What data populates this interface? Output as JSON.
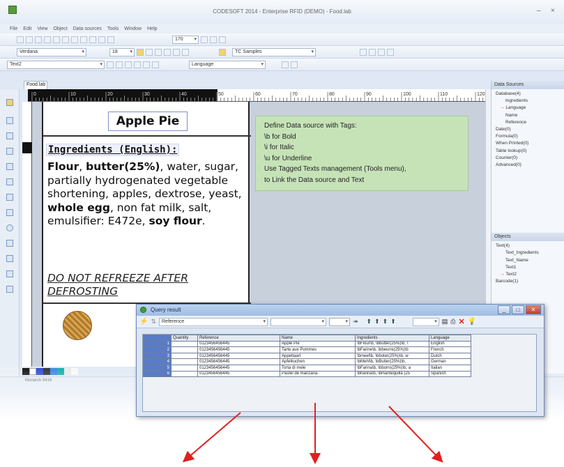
{
  "window": {
    "title": "CODESOFT 2014 - Enterprise RFID (DEMO) - Food.lab",
    "minimize": "–",
    "close": "×"
  },
  "menu": [
    "File",
    "Edit",
    "View",
    "Object",
    "Data sources",
    "Tools",
    "Window",
    "Help"
  ],
  "toolbar": {
    "font_name": "Verdana",
    "font_size": "18",
    "zoom": "170",
    "tc_samples": "TC Samples",
    "object_name": "Text2",
    "language": "Language"
  },
  "document": {
    "tab_label": "Food.lab",
    "ruler_numbers": [
      "0",
      "10",
      "20",
      "30",
      "40",
      "50",
      "60",
      "70",
      "80",
      "90",
      "100",
      "110",
      "120"
    ],
    "label_title": "Apple Pie",
    "ingredients_heading": "Ingredients (English):",
    "ingredients_line1_bold": "Flour",
    "ingredients_line1_rest": ", ",
    "ingredients_line1_bold2": "butter(25%)",
    "ingredients_line1_end": ",",
    "ingredients_body1": "water, sugar, partially hydrogenated vegetable shortening, apples, dextrose, yeast, ",
    "ingredients_bold3": "whole egg",
    "ingredients_body2": ", non fat milk, salt, emulsifier: E472e, ",
    "ingredients_bold4": "soy flour",
    "ingredients_end": ".",
    "warning": "DO NOT REFREEZE AFTER DEFROSTING",
    "note_lines": [
      "Define Data source with Tags:",
      "\\b for Bold",
      "\\i for Italic",
      "\\u for Underline",
      "Use Tagged Texts management (Tools menu),",
      "to Link the Data source and Text"
    ]
  },
  "data_sources_panel": {
    "title": "Data Sources",
    "items": [
      "Database(4)",
      "Ingredients",
      "Language",
      "Name",
      "Reference",
      "Date(0)",
      "Formula(0)",
      "When Printed(0)",
      "Table lookup(0)",
      "Counter(0)",
      "Advanced(0)"
    ]
  },
  "objects_panel": {
    "title": "Objects",
    "items": [
      "Text(4)",
      "Text_Ingredients",
      "Text_Name",
      "Text1",
      "Text2",
      "Barcode(1)"
    ]
  },
  "status": {
    "printer": "Monarch 9416"
  },
  "query_dialog": {
    "title": "Query result",
    "filter_field": "Reference",
    "columns": [
      "Quantity",
      "Reference",
      "Name",
      "Ingredients",
      "Language"
    ],
    "rows": [
      {
        "idx": "1",
        "quantity": "",
        "reference": "0123456456445",
        "name": "Apple Pie",
        "ingredients": "\\bFlour\\b, \\bbutter(25%)\\b, \\",
        "language": "English"
      },
      {
        "idx": "2",
        "quantity": "",
        "reference": "0123456456445",
        "name": "Tarte aux Pommes",
        "ingredients": "\\bFarine\\b, \\bbeurre(25%)\\b",
        "language": "French"
      },
      {
        "idx": "3",
        "quantity": "",
        "reference": "0123456456445",
        "name": "Appeltaart",
        "ingredients": "\\bmeel\\b, \\bboter(25%)\\b, w",
        "language": "Dutch"
      },
      {
        "idx": "4",
        "quantity": "",
        "reference": "0123456456445",
        "name": "Apfelkuchen",
        "ingredients": "\\bMehl\\b, \\bButter(25%)\\b,",
        "language": "German"
      },
      {
        "idx": "5",
        "quantity": "",
        "reference": "0123456456445",
        "name": "Torta di mele",
        "ingredients": "\\bFarina\\b, \\bburro(25%)\\b, a",
        "language": "Italian"
      },
      {
        "idx": "6",
        "quantity": "",
        "reference": "0123456456445",
        "name": "Pastel de manzana",
        "ingredients": "\\bharina\\b, \\bmantequilla (25",
        "language": "Spanish"
      }
    ]
  },
  "colors": {
    "note_bg": "#c6e3b8",
    "arrow": "#e02020",
    "row_index": "#5a7bc6"
  }
}
